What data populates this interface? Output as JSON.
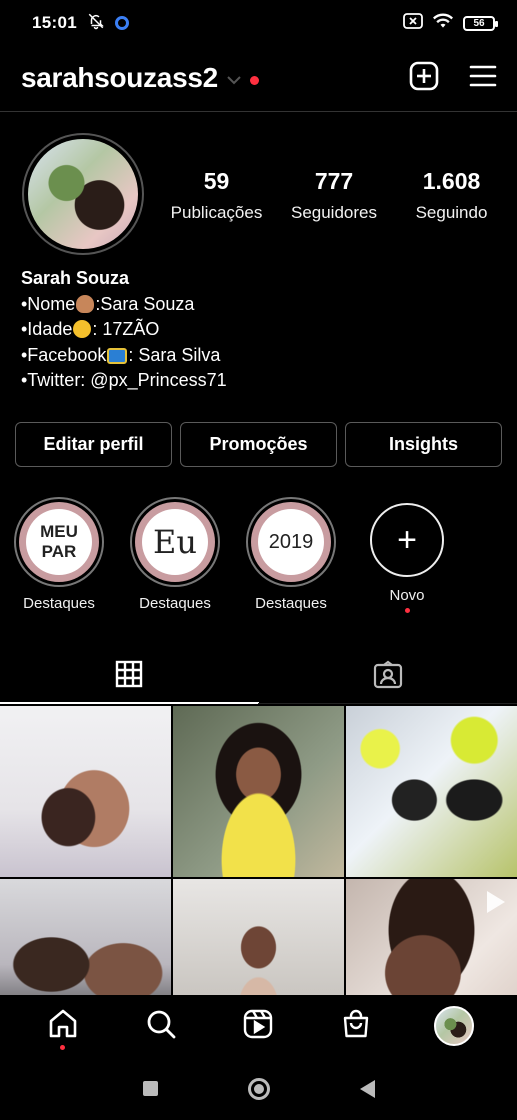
{
  "status_bar": {
    "time": "15:01",
    "battery": "56",
    "icons": [
      "mute-bell-icon",
      "assistant-ring-icon",
      "sim-x-icon",
      "wifi-icon",
      "battery-icon"
    ]
  },
  "header": {
    "username": "sarahsouzass2",
    "icons": [
      "chevron-down-icon",
      "new-post-icon",
      "menu-icon"
    ],
    "notification_color": "#ff3040"
  },
  "profile": {
    "stats": [
      {
        "value": "59",
        "label": "Publicações"
      },
      {
        "value": "777",
        "label": "Seguidores"
      },
      {
        "value": "1.608",
        "label": "Seguindo"
      }
    ],
    "bio": {
      "name": "Sarah Souza",
      "line1_prefix": "•Nome",
      "line1_suffix": ":Sara Souza",
      "line2_prefix": "•Idade",
      "line2_suffix": ": 17ZÃO",
      "line3_prefix": "•Facebook",
      "line3_suffix": ": Sara Silva",
      "line4": "•Twitter: @px_Princess71"
    },
    "buttons": {
      "edit": "Editar perfil",
      "promotions": "Promoções",
      "insights": "Insights"
    }
  },
  "highlights": [
    {
      "cover": "MEU PAR",
      "label": "Destaques"
    },
    {
      "cover": "Eu",
      "label": "Destaques"
    },
    {
      "cover": "2019",
      "label": "Destaques"
    },
    {
      "cover": "+",
      "label": "Novo"
    }
  ],
  "tabs": [
    "grid-icon",
    "tagged-icon"
  ],
  "posts": [
    {
      "type": "photo"
    },
    {
      "type": "photo"
    },
    {
      "type": "photo"
    },
    {
      "type": "photo"
    },
    {
      "type": "photo"
    },
    {
      "type": "video"
    }
  ],
  "bottom_nav": [
    "home-icon",
    "search-icon",
    "reels-icon",
    "shop-icon",
    "profile-avatar"
  ],
  "system_nav": [
    "recents-button",
    "home-button",
    "back-button"
  ]
}
